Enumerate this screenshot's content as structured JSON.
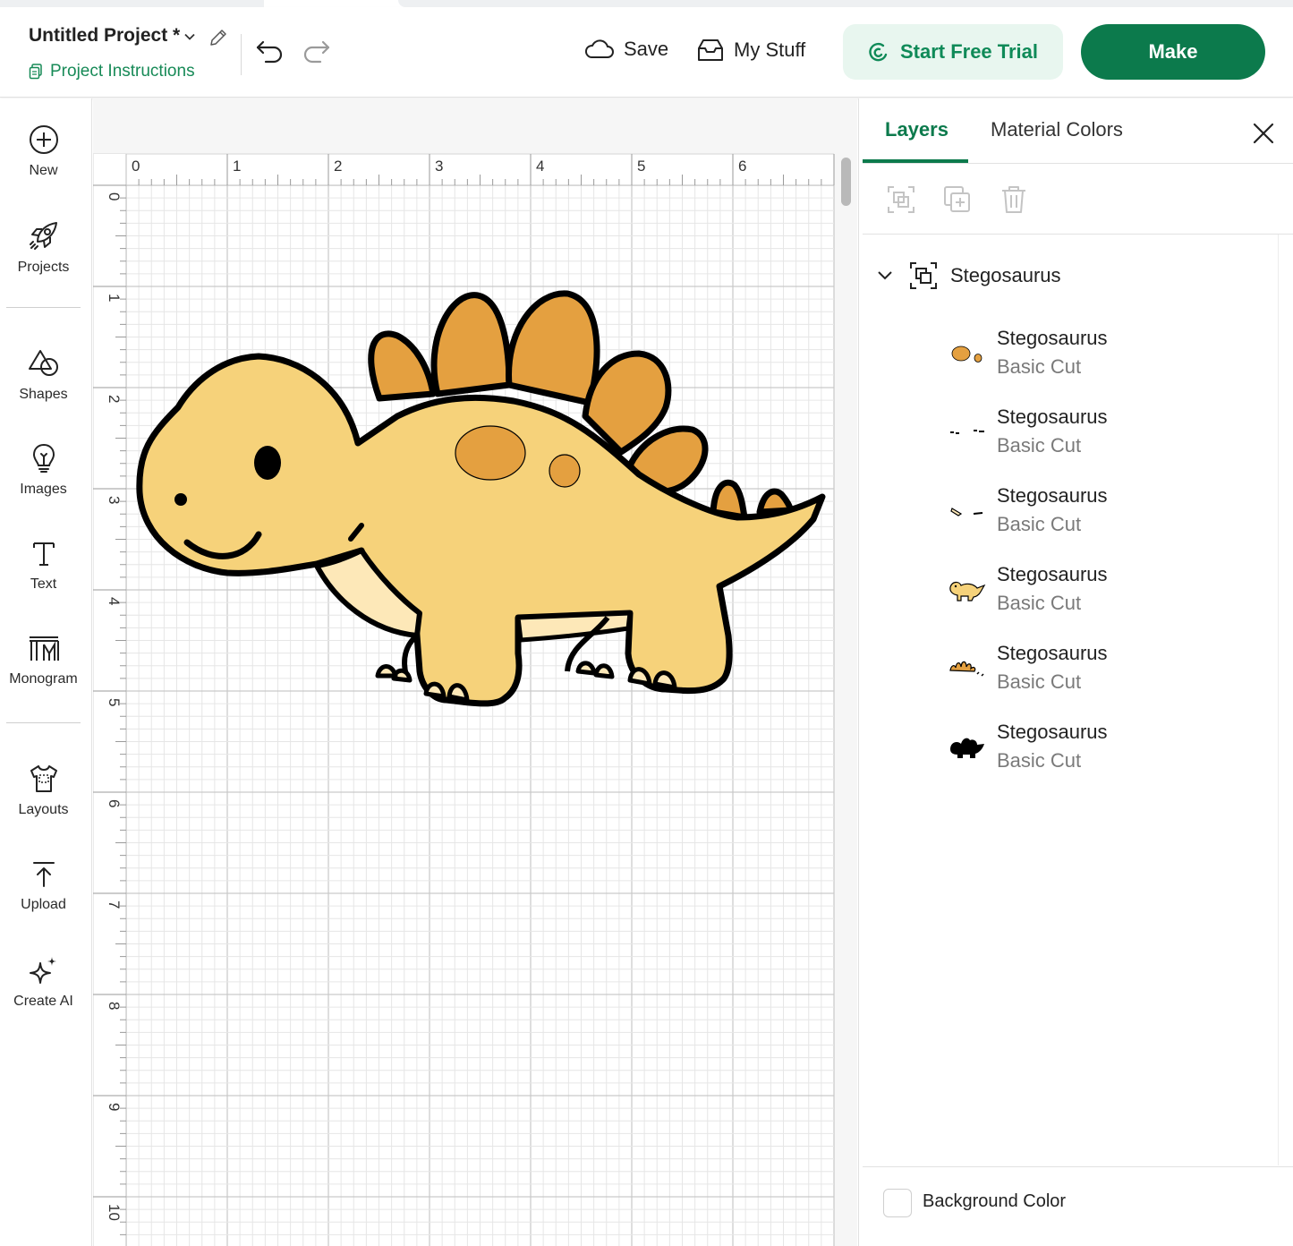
{
  "header": {
    "project_title": "Untitled Project *",
    "project_instructions": "Project Instructions",
    "save_label": "Save",
    "my_stuff_label": "My Stuff",
    "trial_label": "Start Free Trial",
    "make_label": "Make"
  },
  "sidebar": {
    "items": [
      {
        "label": "New",
        "icon": "plus-circle-icon"
      },
      {
        "label": "Projects",
        "icon": "rocket-icon"
      },
      {
        "label": "Shapes",
        "icon": "shapes-icon"
      },
      {
        "label": "Images",
        "icon": "lightbulb-icon"
      },
      {
        "label": "Text",
        "icon": "text-icon"
      },
      {
        "label": "Monogram",
        "icon": "monogram-icon"
      },
      {
        "label": "Layouts",
        "icon": "tshirt-icon"
      },
      {
        "label": "Upload",
        "icon": "upload-icon"
      },
      {
        "label": "Create AI",
        "icon": "sparkle-icon"
      }
    ]
  },
  "canvas": {
    "ruler_top": [
      "0",
      "1",
      "2",
      "3",
      "4",
      "5",
      "6"
    ],
    "ruler_left": [
      "0",
      "1",
      "2",
      "3",
      "4",
      "5",
      "6",
      "7",
      "8",
      "9",
      "10"
    ],
    "colors": {
      "body": "#F6D27A",
      "plates": "#E4A040",
      "belly": "#FDE8B8",
      "outline": "#000000"
    }
  },
  "panel": {
    "tabs": [
      "Layers",
      "Material Colors"
    ],
    "active_tab": "Layers",
    "group_name": "Stegosaurus",
    "layers": [
      {
        "name": "Stegosaurus",
        "operation": "Basic Cut",
        "thumb": "spots"
      },
      {
        "name": "Stegosaurus",
        "operation": "Basic Cut",
        "thumb": "eyes"
      },
      {
        "name": "Stegosaurus",
        "operation": "Basic Cut",
        "thumb": "belly"
      },
      {
        "name": "Stegosaurus",
        "operation": "Basic Cut",
        "thumb": "body"
      },
      {
        "name": "Stegosaurus",
        "operation": "Basic Cut",
        "thumb": "plates"
      },
      {
        "name": "Stegosaurus",
        "operation": "Basic Cut",
        "thumb": "silhouette"
      }
    ],
    "background_color_label": "Background Color"
  },
  "colors": {
    "accent": "#0C7A4C",
    "trial_bg": "#E8F6EF"
  }
}
